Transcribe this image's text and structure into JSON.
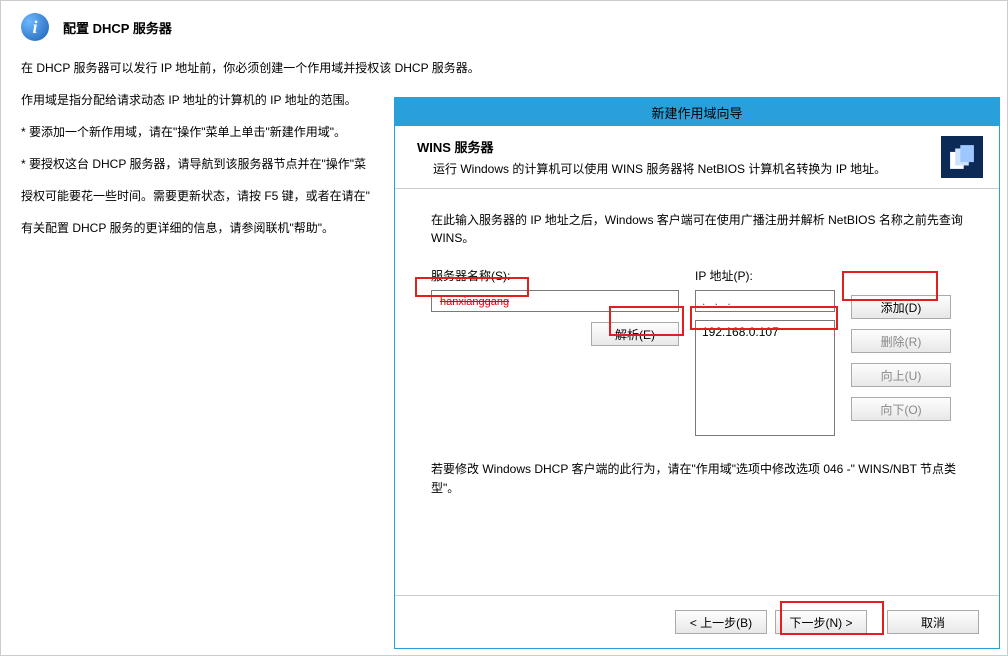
{
  "background": {
    "title": "配置 DHCP 服务器",
    "lines": [
      "在 DHCP 服务器可以发行 IP 地址前，你必须创建一个作用域并授权该 DHCP 服务器。",
      "作用域是指分配给请求动态 IP 地址的计算机的 IP 地址的范围。",
      "* 要添加一个新作用域，请在\"操作\"菜单上单击\"新建作用域\"。",
      "* 要授权这台 DHCP 服务器，请导航到该服务器节点并在\"操作\"菜",
      "授权可能要花一些时间。需要更新状态，请按 F5 键，或者在请在\"",
      "有关配置 DHCP 服务的更详细的信息，请参阅联机\"帮助\"。"
    ]
  },
  "wizard": {
    "window_title": "新建作用域向导",
    "header_title": "WINS 服务器",
    "header_sub": "运行 Windows 的计算机可以使用 WINS 服务器将 NetBIOS 计算机名转换为 IP 地址。",
    "intro": "在此输入服务器的 IP 地址之后，Windows 客户端可在使用广播注册并解析 NetBIOS 名称之前先查询 WINS。",
    "server_name_label": "服务器名称(S):",
    "server_name_value": "hanxianggang",
    "ip_label": "IP 地址(P):",
    "ip_field_dots": ".       .       .",
    "ip_list": [
      "192.168.0.107"
    ],
    "resolve_label": "解析(E)",
    "add_label": "添加(D)",
    "remove_label": "删除(R)",
    "up_label": "向上(U)",
    "down_label": "向下(O)",
    "footer_note": "若要修改 Windows DHCP 客户端的此行为，请在\"作用域\"选项中修改选项 046 -\" WINS/NBT 节点类型\"。",
    "back_label": "< 上一步(B)",
    "next_label": "下一步(N) >",
    "cancel_label": "取消"
  }
}
